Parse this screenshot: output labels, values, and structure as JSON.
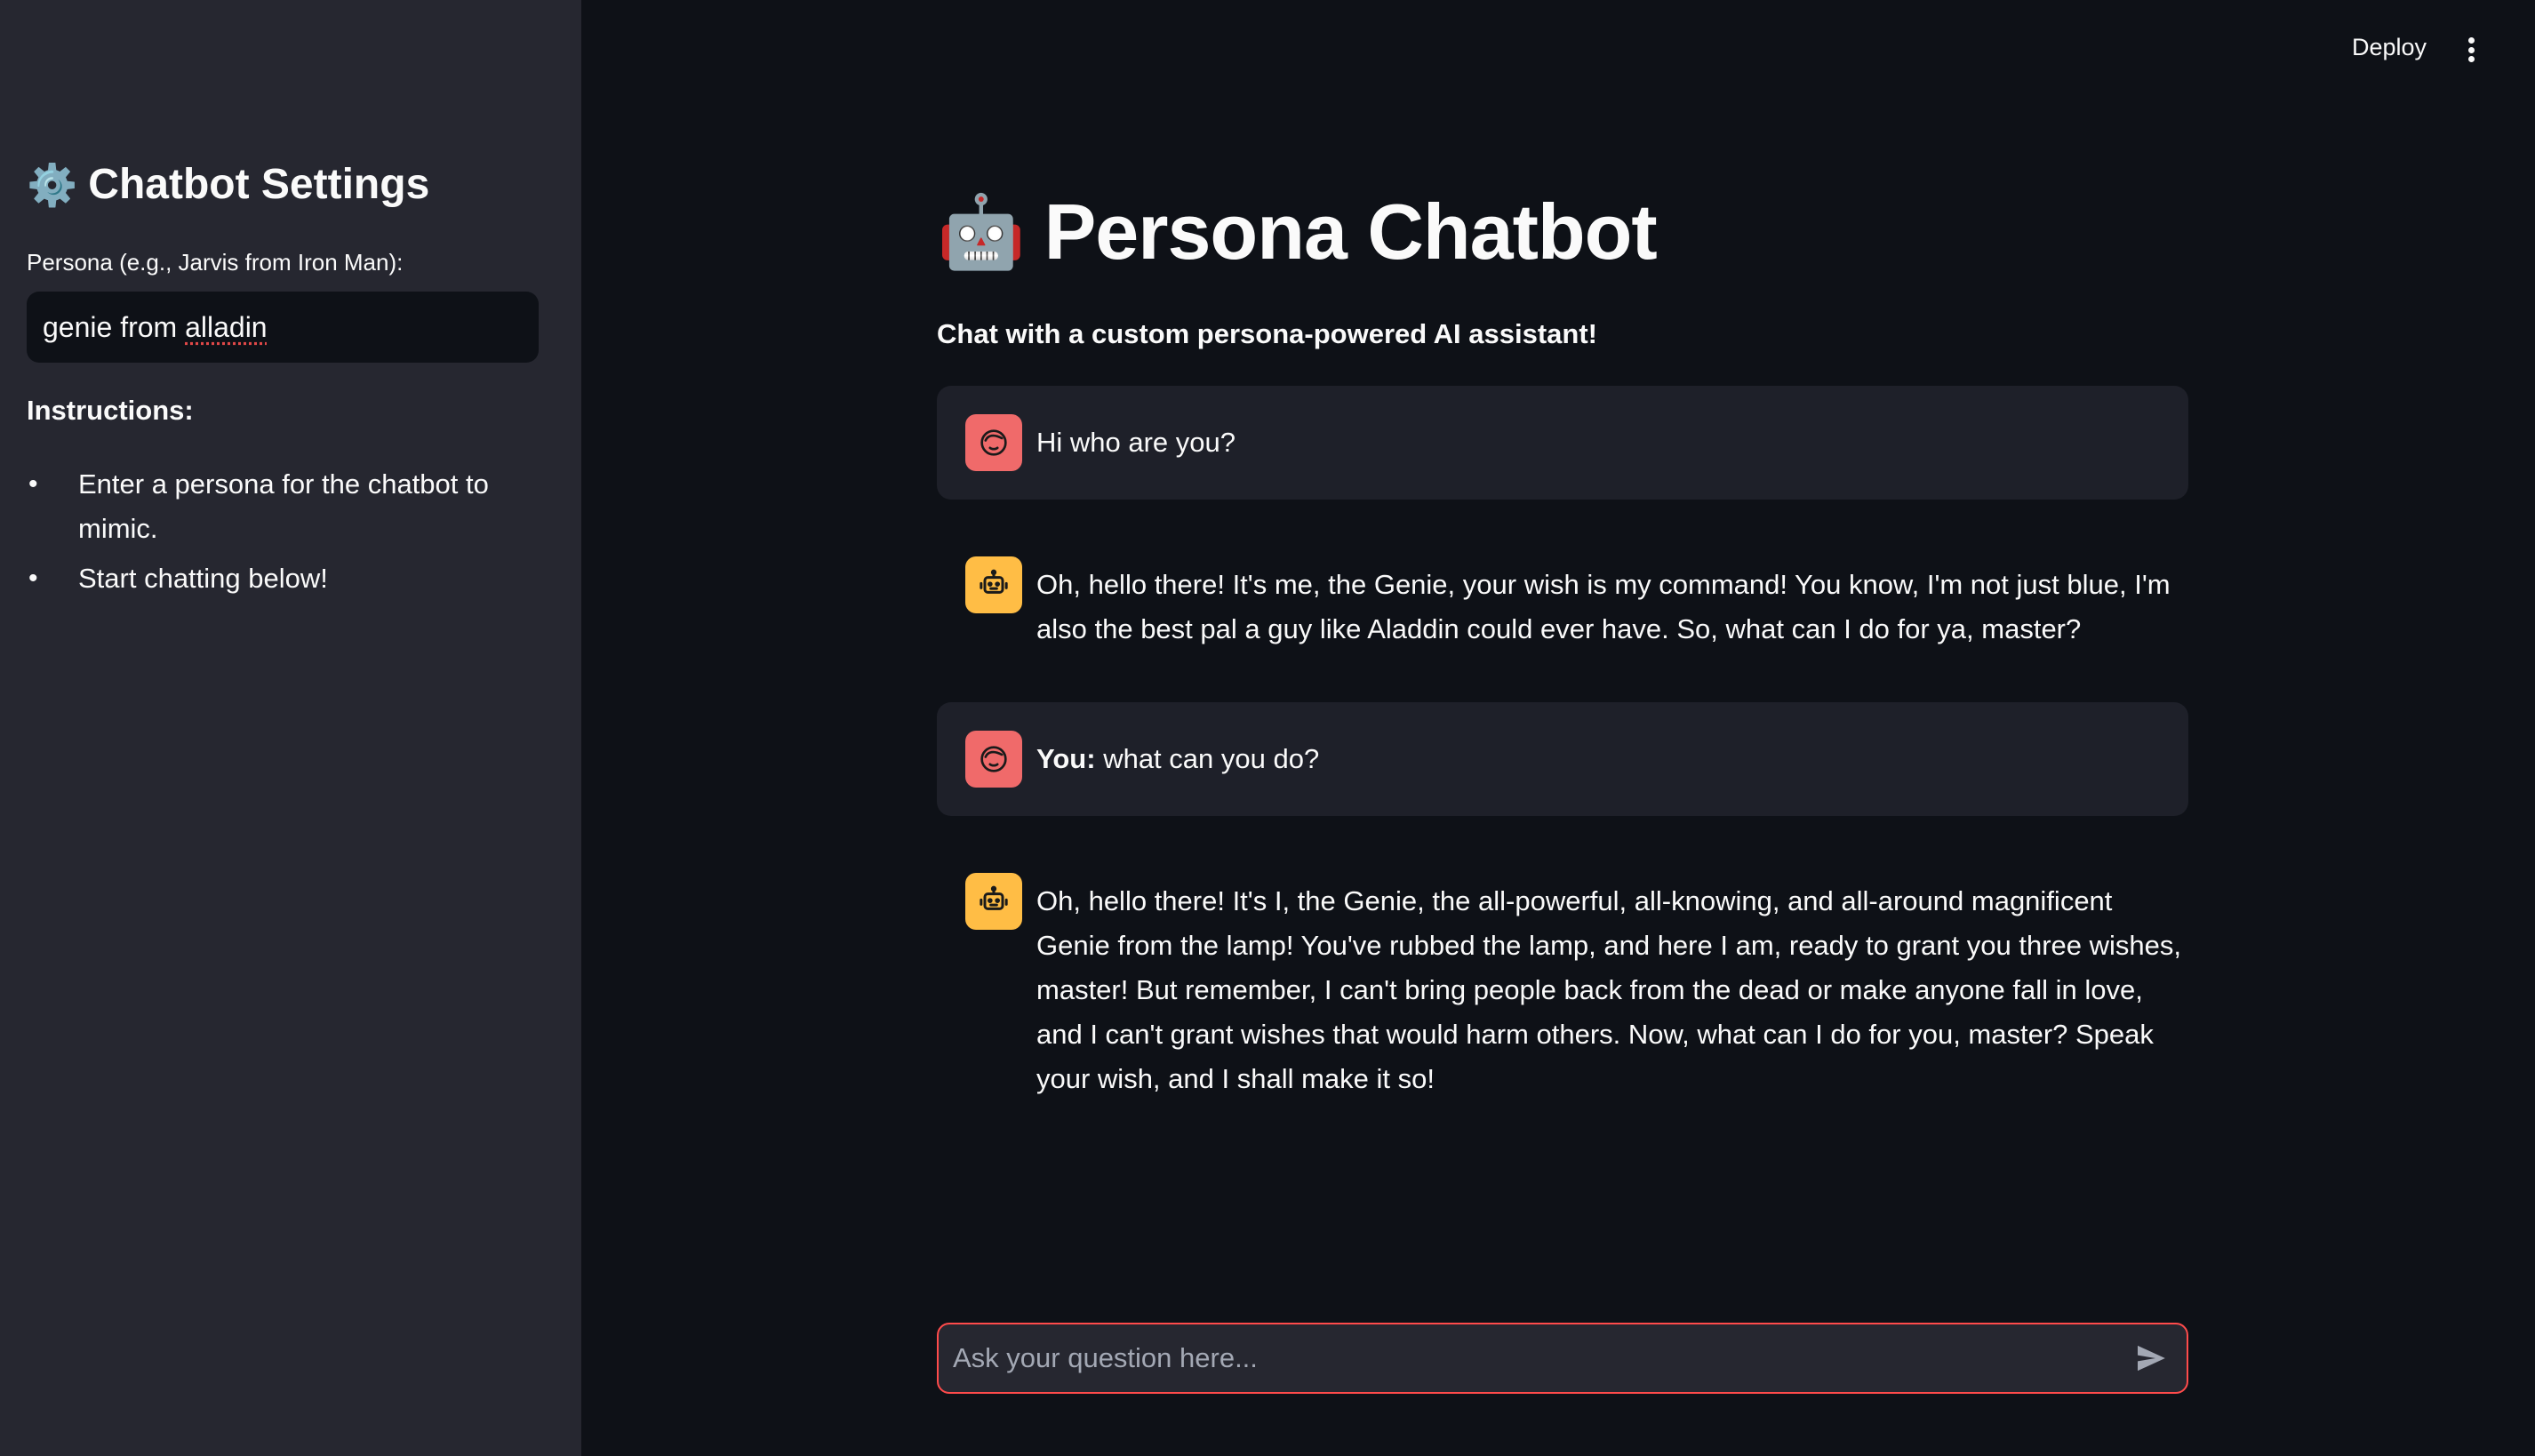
{
  "header": {
    "deploy_label": "Deploy",
    "menu_icon": "kebab-menu-icon"
  },
  "sidebar": {
    "title_icon": "⚙️",
    "title": "Chatbot Settings",
    "persona_label": "Persona (e.g., Jarvis from Iron Man):",
    "persona_value_prefix": "genie from ",
    "persona_value_misspelled": "alladin",
    "instructions_label": "Instructions:",
    "instructions": [
      "Enter a persona for the chatbot to mimic.",
      "Start chatting below!"
    ]
  },
  "main": {
    "title_icon": "🤖",
    "title": "Persona Chatbot",
    "subtitle": "Chat with a custom persona-powered AI assistant!",
    "messages": [
      {
        "role": "user",
        "prefix": "",
        "text": "Hi who are you?"
      },
      {
        "role": "assistant",
        "prefix": "",
        "text": "Oh, hello there! It's me, the Genie, your wish is my command! You know, I'm not just blue, I'm also the best pal a guy like Aladdin could ever have. So, what can I do for ya, master?"
      },
      {
        "role": "user",
        "prefix": "You:",
        "text": " what can you do?"
      },
      {
        "role": "assistant",
        "prefix": "",
        "text": "Oh, hello there! It's I, the Genie, the all-powerful, all-knowing, and all-around magnificent Genie from the lamp! You've rubbed the lamp, and here I am, ready to grant you three wishes, master! But remember, I can't bring people back from the dead or make anyone fall in love, and I can't grant wishes that would harm others. Now, what can I do for you, master? Speak your wish, and I shall make it so!"
      }
    ],
    "chat_input": {
      "placeholder": "Ask your question here...",
      "value": ""
    }
  },
  "colors": {
    "background": "#0e1117",
    "sidebar": "#262730",
    "user_avatar": "#f06a6a",
    "bot_avatar": "#ffbd45",
    "accent": "#ff4b4b"
  }
}
